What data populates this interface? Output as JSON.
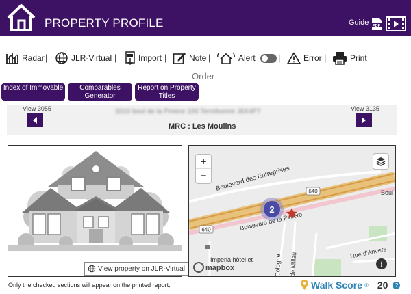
{
  "header": {
    "title": "PROPERTY PROFILE",
    "guide_label": "Guide",
    "pdf_label": "PDF",
    "colors": {
      "primary": "#3d1163",
      "text": "#ffffff"
    }
  },
  "toolbar": {
    "items": [
      {
        "label": "Radar",
        "icon": "radar-icon"
      },
      {
        "label": "JLR-Virtual",
        "icon": "globe-icon"
      },
      {
        "label": "Import",
        "icon": "import-icon"
      },
      {
        "label": "Note",
        "icon": "note-icon"
      },
      {
        "label": "Alert",
        "icon": "alert-house-icon",
        "toggle": "off"
      },
      {
        "label": "Error",
        "icon": "warning-icon"
      },
      {
        "label": "Print",
        "icon": "printer-icon"
      }
    ],
    "separator": "|"
  },
  "order": {
    "label": "Order",
    "buttons": [
      {
        "label": "Index of Immovable"
      },
      {
        "label": "Comparables Generator"
      },
      {
        "label": "Report on Property Titles"
      }
    ]
  },
  "navigation": {
    "prev_label": "View 3055",
    "next_label": "View 3135",
    "address": "3310 boul de la Piniere 100 Terrebonne J6X4P7",
    "mrc": "MRC : Les Moulins"
  },
  "photo": {
    "link_label": "View property on JLR-Virtual"
  },
  "map": {
    "zoom_in": "+",
    "zoom_out": "−",
    "labels": {
      "street1": "Boulevard des Entreprises",
      "street2": "Boulevard de la Pinière",
      "street3": "Boul",
      "street4": "Rue d'Anvers",
      "street5": "Cologne",
      "street6": "de Millau",
      "poi": "Imperia hôtel et",
      "route_a": "640",
      "route_b": "640",
      "cluster": "2",
      "brand": "mapbox"
    }
  },
  "footer": {
    "note": "Only the checked sections will appear on the printed report.",
    "walk_label": "Walk Score",
    "walk_reg": "®",
    "walk_value": "20",
    "help": "?"
  }
}
